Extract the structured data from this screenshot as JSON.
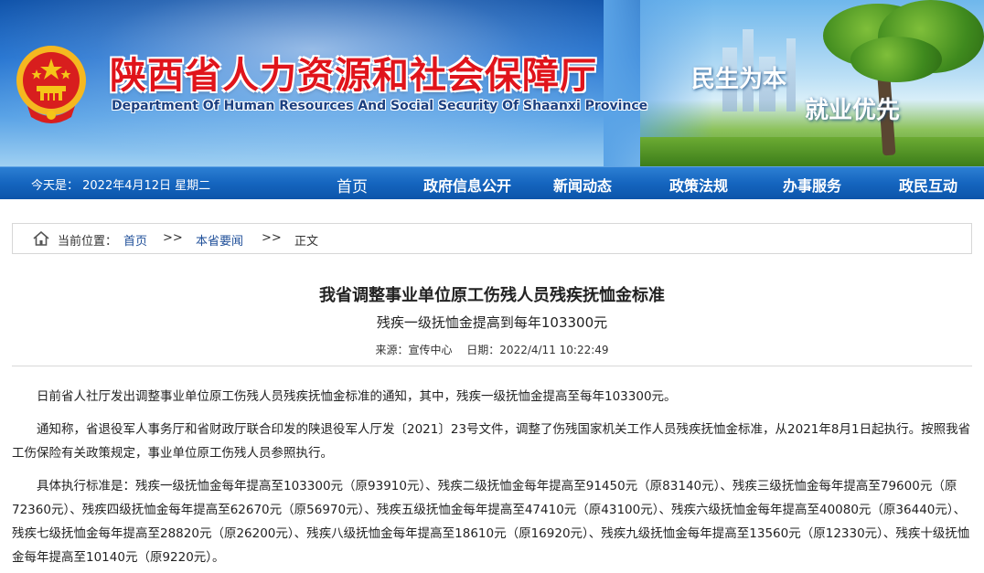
{
  "header": {
    "title_cn": "陕西省人力资源和社会保障厅",
    "title_en": "Department Of Human Resources And Social Security Of Shaanxi Province",
    "slogan_1": "民生为本",
    "slogan_2": "就业优先",
    "colors": {
      "title_red": "#e0141b",
      "banner_blue": "#1d6fcf"
    }
  },
  "nav": {
    "date_text": "今天是： 2022年4月12日 星期二",
    "items": [
      {
        "label": "首页"
      },
      {
        "label": "政府信息公开"
      },
      {
        "label": "新闻动态"
      },
      {
        "label": "政策法规"
      },
      {
        "label": "办事服务"
      },
      {
        "label": "政民互动"
      }
    ]
  },
  "breadcrumb": {
    "prefix": "当前位置：",
    "home": "首页",
    "sep": ">>",
    "section": "本省要闻",
    "current": "正文"
  },
  "article": {
    "title": "我省调整事业单位原工伤残人员残疾抚恤金标准",
    "subtitle": "残疾一级抚恤金提高到每年103300元",
    "source": "来源：宣传中心",
    "date": "日期：2022/4/11 10:22:49",
    "paragraphs": [
      "日前省人社厅发出调整事业单位原工伤残人员残疾抚恤金标准的通知，其中，残疾一级抚恤金提高至每年103300元。",
      "通知称，省退役军人事务厅和省财政厅联合印发的陕退役军人厅发〔2021〕23号文件，调整了伤残国家机关工作人员残疾抚恤金标准，从2021年8月1日起执行。按照我省工伤保险有关政策规定，事业单位原工伤残人员参照执行。",
      "具体执行标准是：残疾一级抚恤金每年提高至103300元（原93910元）、残疾二级抚恤金每年提高至91450元（原83140元）、残疾三级抚恤金每年提高至79600元（原72360元）、残疾四级抚恤金每年提高至62670元（原56970元）、残疾五级抚恤金每年提高至47410元（原43100元）、残疾六级抚恤金每年提高至40080元（原36440元）、残疾七级抚恤金每年提高至28820元（原26200元）、残疾八级抚恤金每年提高至18610元（原16920元）、残疾九级抚恤金每年提高至13560元（原12330元）、残疾十级抚恤金每年提高至10140元（原9220元）。"
    ]
  }
}
